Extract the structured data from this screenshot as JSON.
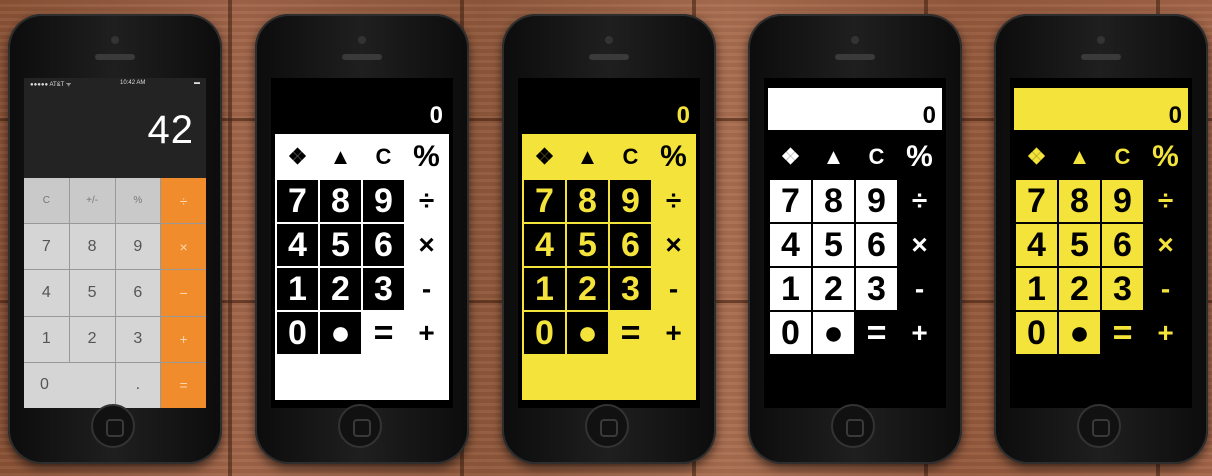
{
  "ios_phone": {
    "status_left": "●●●●● AT&T ᯤ",
    "status_time": "10:42 AM",
    "status_battery": "▬",
    "display": "42",
    "keys": [
      "C",
      "+/-",
      "%",
      "÷",
      "7",
      "8",
      "9",
      "×",
      "4",
      "5",
      "6",
      "−",
      "1",
      "2",
      "3",
      "+",
      "0",
      ".",
      "="
    ]
  },
  "large_calcs": [
    {
      "variant": "v2",
      "display": "0"
    },
    {
      "variant": "v3",
      "display": "0"
    },
    {
      "variant": "v4",
      "display": "0"
    },
    {
      "variant": "v5",
      "display": "0"
    }
  ],
  "large_keys": [
    {
      "label": "❖",
      "kind": "top",
      "name": "menu-key"
    },
    {
      "label": "▲",
      "kind": "top",
      "name": "up-key"
    },
    {
      "label": "C",
      "kind": "top",
      "name": "clear-key"
    },
    {
      "label": "%",
      "kind": "top pct",
      "name": "percent-key"
    },
    {
      "label": "7",
      "kind": "digit",
      "name": "key-7"
    },
    {
      "label": "8",
      "kind": "digit",
      "name": "key-8"
    },
    {
      "label": "9",
      "kind": "digit",
      "name": "key-9"
    },
    {
      "label": "÷",
      "kind": "op",
      "name": "divide-key"
    },
    {
      "label": "4",
      "kind": "digit",
      "name": "key-4"
    },
    {
      "label": "5",
      "kind": "digit",
      "name": "key-5"
    },
    {
      "label": "6",
      "kind": "digit",
      "name": "key-6"
    },
    {
      "label": "×",
      "kind": "op",
      "name": "multiply-key"
    },
    {
      "label": "1",
      "kind": "digit",
      "name": "key-1"
    },
    {
      "label": "2",
      "kind": "digit",
      "name": "key-2"
    },
    {
      "label": "3",
      "kind": "digit",
      "name": "key-3"
    },
    {
      "label": "-",
      "kind": "op",
      "name": "minus-key"
    },
    {
      "label": "0",
      "kind": "digit",
      "name": "key-0"
    },
    {
      "label": "●",
      "kind": "digit",
      "name": "decimal-key"
    },
    {
      "label": "=",
      "kind": "eq",
      "name": "equals-key"
    },
    {
      "label": "+",
      "kind": "op",
      "name": "plus-key"
    }
  ],
  "colors": {
    "yellow": "#f3e33a",
    "ios_orange": "#f08c2c",
    "black": "#000000",
    "white": "#ffffff"
  }
}
